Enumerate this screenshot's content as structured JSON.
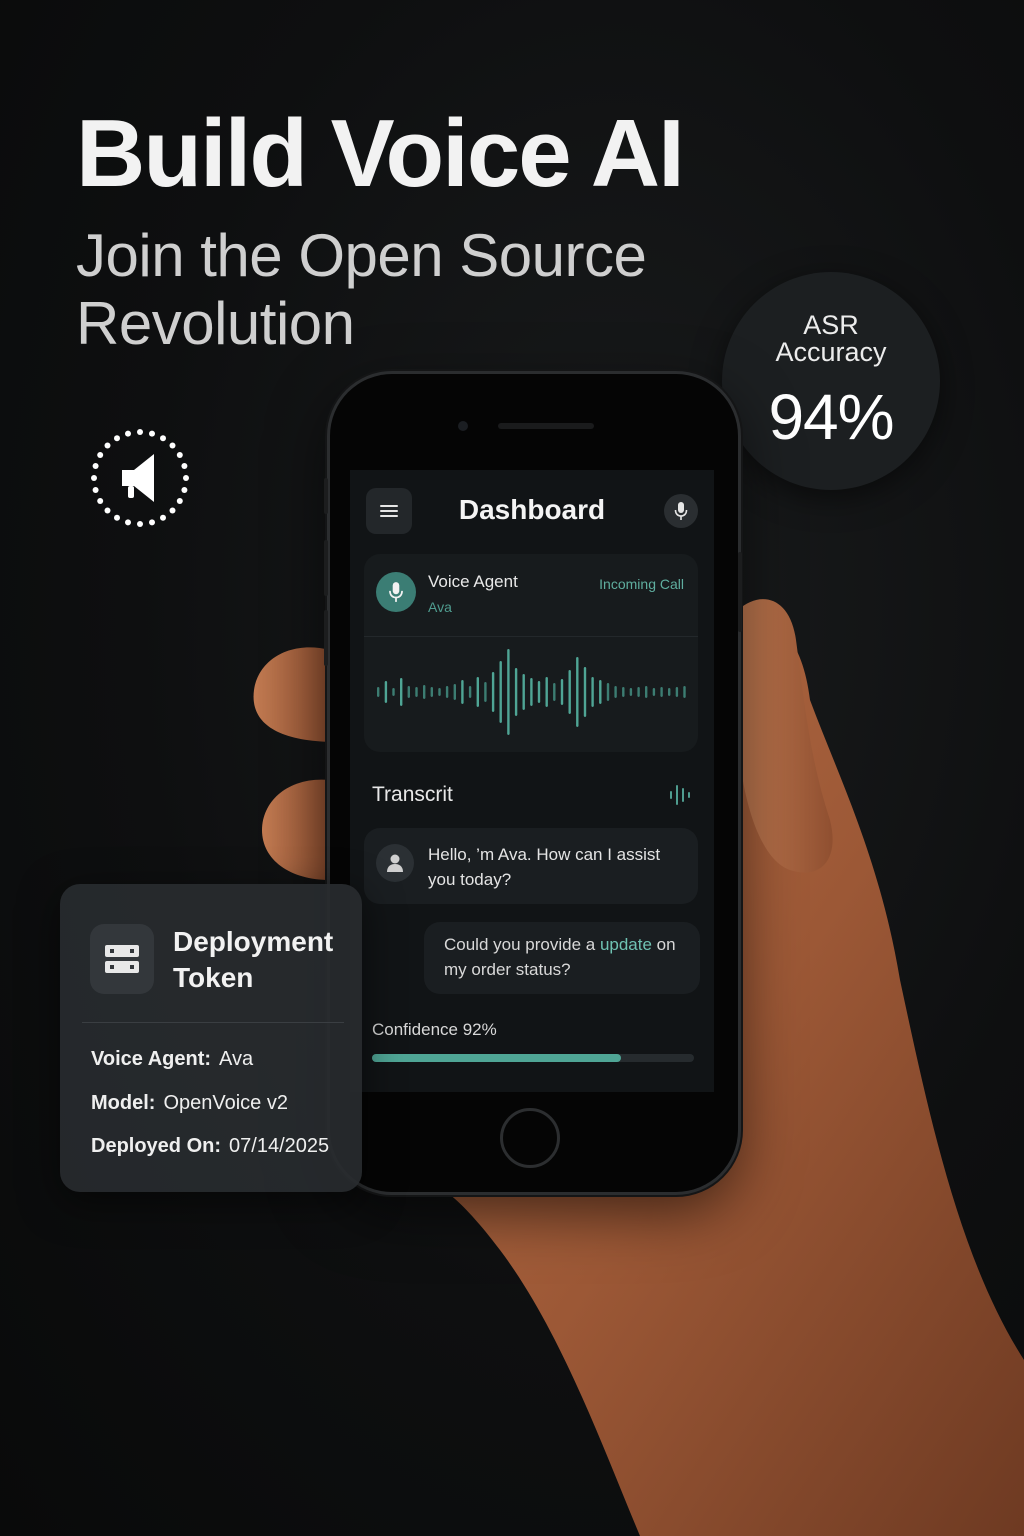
{
  "hero": {
    "headline": "Build Voice AI",
    "subheadline": "Join the Open Source Revolution"
  },
  "asr_badge": {
    "label": "ASR Accuracy",
    "value": "94%"
  },
  "app": {
    "title": "Dashboard",
    "agent_card": {
      "name": "Voice Agent",
      "agent": "Ava",
      "status": "Incoming Call"
    },
    "transcript": {
      "title": "Transcrit",
      "agent_message": "Hello, ’m Ava. How can I assist you today?",
      "user_message_before": "Could you provide a ",
      "user_message_highlight": "update",
      "user_message_after": " on my order status?"
    },
    "confidence": {
      "label": "Confidence 92%",
      "value": 0.92
    }
  },
  "deployment_card": {
    "title": "Deployment Token",
    "rows": [
      {
        "key": "Voice Agent:",
        "value": "Ava"
      },
      {
        "key": "Model:",
        "value": "OpenVoice v2"
      },
      {
        "key": "Deployed On:",
        "value": "07/14/2025"
      }
    ]
  },
  "colors": {
    "accent": "#4fa595",
    "background": "#0e0f10",
    "card": "#171b1d"
  },
  "icons": [
    "loader-icon",
    "hamburger-menu-icon",
    "microphone-icon",
    "user-icon",
    "server-icon",
    "waveform-icon"
  ]
}
